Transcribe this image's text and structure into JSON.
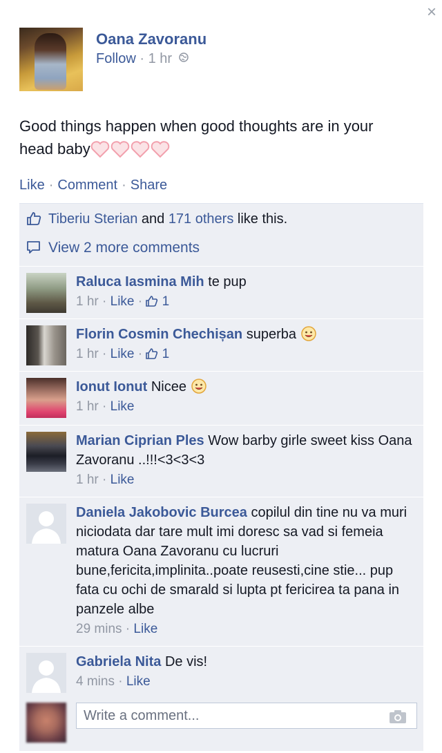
{
  "close_label": "×",
  "post": {
    "author": "Oana Zavoranu",
    "follow": "Follow",
    "meta_sep": " · ",
    "time": "1 hr",
    "text": "Good things happen when good thoughts are in your head baby",
    "heart_icons": [
      "heart-icon",
      "heart-icon",
      "heart-icon",
      "heart-icon"
    ]
  },
  "actions": {
    "like": "Like",
    "comment": "Comment",
    "share": "Share",
    "sep": "·"
  },
  "likes": {
    "first_name": "Tiberiu Sterian",
    "and": " and ",
    "others": "171 others",
    "suffix": " like this."
  },
  "view_more": "View 2 more comments",
  "comments": [
    {
      "name": "Raluca Iasmina Mih",
      "text": "te pup",
      "time": "1 hr",
      "like": "Like",
      "likes": "1"
    },
    {
      "name": "Florin Cosmin Chechișan",
      "text": "superba",
      "time": "1 hr",
      "like": "Like",
      "likes": "1"
    },
    {
      "name": "Ionut Ionut",
      "text": "Nicee",
      "time": "1 hr",
      "like": "Like"
    },
    {
      "name": "Marian Ciprian Ples",
      "text": "Wow barby girle sweet kiss Oana Zavoranu ..!!!<3<3<3",
      "time": "1 hr",
      "like": "Like"
    },
    {
      "name": "Daniela Jakobovic Burcea",
      "text": "copilul din tine nu va muri niciodata dar tare mult imi doresc sa vad si femeia matura Oana Zavoranu cu lucruri bune,fericita,implinita..poate reusesti,cine stie... pup fata cu ochi de smarald si lupta pt fericirea ta pana in panzele albe",
      "time": "29 mins",
      "like": "Like"
    },
    {
      "name": "Gabriela Nita",
      "text": "De vis!",
      "time": "4 mins",
      "like": "Like"
    }
  ],
  "write_comment_placeholder": "Write a comment...",
  "colors": {
    "link": "#3b5998",
    "meta": "#9197a3",
    "feedback_bg": "#edeff4",
    "heart_pink": "#f7a5b0"
  }
}
